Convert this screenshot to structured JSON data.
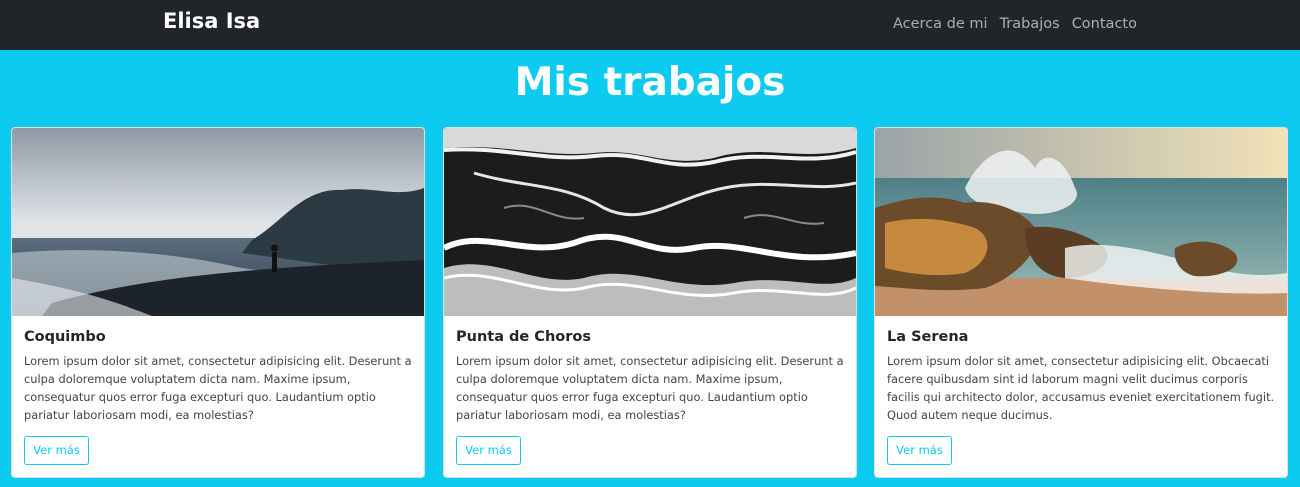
{
  "navbar": {
    "brand": "Elisa Isa",
    "links": [
      "Acerca de mi",
      "Trabajos",
      "Contacto"
    ]
  },
  "works": {
    "title": "Mis trabajos",
    "cards": [
      {
        "title": "Coquimbo",
        "text": "Lorem ipsum dolor sit amet, consectetur adipisicing elit. Deserunt a culpa doloremque voluptatem dicta nam. Maxime ipsum, consequatur quos error fuga excepturi quo. Laudantium optio pariatur laboriosam modi, ea molestias?",
        "button": "Ver más"
      },
      {
        "title": "Punta de Choros",
        "text": "Lorem ipsum dolor sit amet, consectetur adipisicing elit. Deserunt a culpa doloremque voluptatem dicta nam. Maxime ipsum, consequatur quos error fuga excepturi quo. Laudantium optio pariatur laboriosam modi, ea molestias?",
        "button": "Ver más"
      },
      {
        "title": "La Serena",
        "text": "Lorem ipsum dolor sit amet, consectetur adipisicing elit. Obcaecati facere quibusdam sint id laborum magni velit ducimus corporis facilis qui architecto dolor, accusamus eveniet exercitationem fugit. Quod autem neque ducimus.",
        "button": "Ver más"
      }
    ]
  },
  "colors": {
    "navbar": "#212529",
    "background": "#0dcaf0",
    "accent": "#0dcaf0"
  }
}
